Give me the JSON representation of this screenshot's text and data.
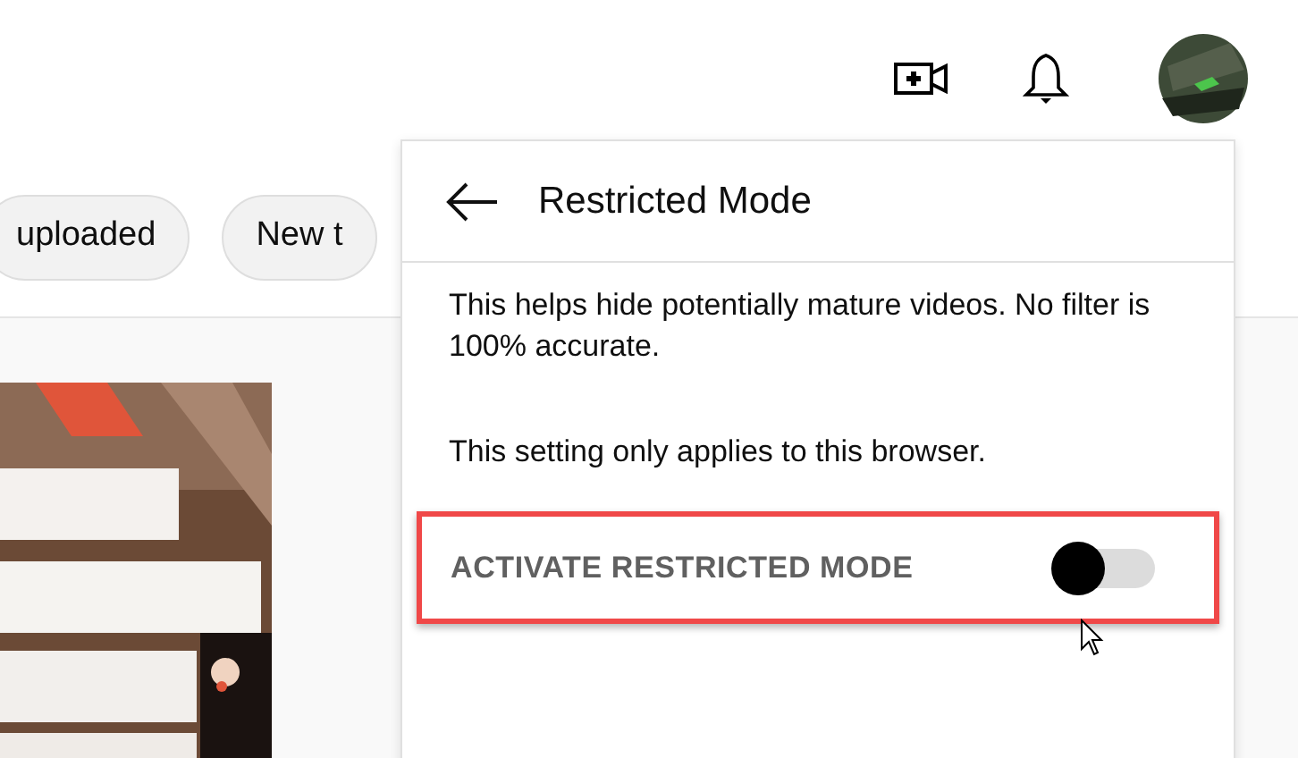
{
  "chips": [
    {
      "label": "uploaded"
    },
    {
      "label": "New t"
    }
  ],
  "panel": {
    "title": "Restricted Mode",
    "paragraphs": [
      "This helps hide potentially mature videos. No filter is 100% accurate.",
      "This setting only applies to this browser."
    ],
    "toggle": {
      "label": "ACTIVATE RESTRICTED MODE",
      "on": false,
      "highlighted": true
    }
  }
}
